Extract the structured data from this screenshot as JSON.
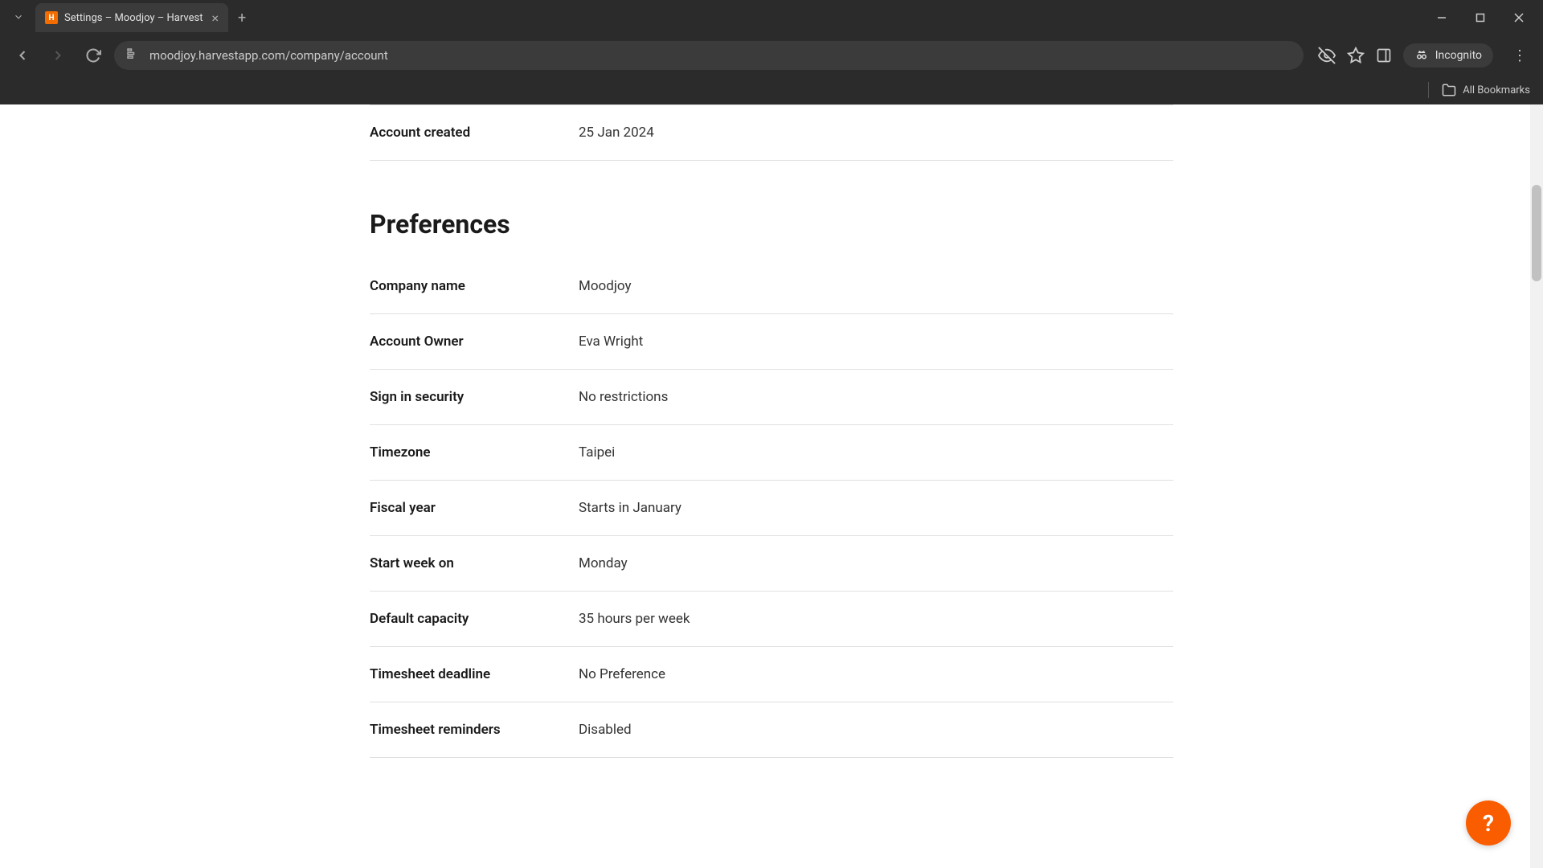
{
  "browser": {
    "tab_title": "Settings – Moodjoy – Harvest",
    "url": "moodjoy.harvestapp.com/company/account",
    "incognito_label": "Incognito",
    "all_bookmarks_label": "All Bookmarks"
  },
  "account_section": {
    "created_label": "Account created",
    "created_value": "25 Jan 2024"
  },
  "preferences": {
    "heading": "Preferences",
    "rows": [
      {
        "label": "Company name",
        "value": "Moodjoy"
      },
      {
        "label": "Account Owner",
        "value": "Eva Wright"
      },
      {
        "label": "Sign in security",
        "value": "No restrictions"
      },
      {
        "label": "Timezone",
        "value": "Taipei"
      },
      {
        "label": "Fiscal year",
        "value": "Starts in January"
      },
      {
        "label": "Start week on",
        "value": "Monday"
      },
      {
        "label": "Default capacity",
        "value": "35 hours per week"
      },
      {
        "label": "Timesheet deadline",
        "value": "No Preference"
      },
      {
        "label": "Timesheet reminders",
        "value": "Disabled"
      }
    ]
  },
  "help_button_label": "?"
}
